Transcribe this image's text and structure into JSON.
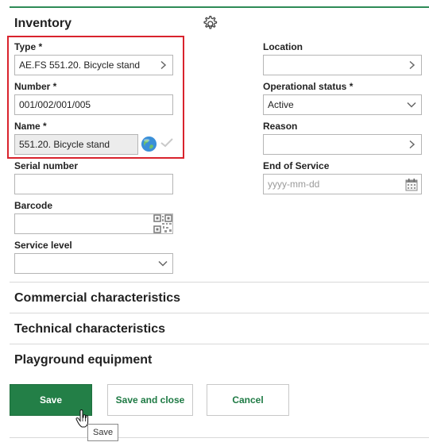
{
  "inventory": {
    "title": "Inventory",
    "left": {
      "type": {
        "label": "Type *",
        "value": "AE.FS 551.20. Bicycle stand"
      },
      "number": {
        "label": "Number *",
        "value": "001/002/001/005"
      },
      "name": {
        "label": "Name *",
        "value": "551.20. Bicycle stand"
      },
      "serial_number": {
        "label": "Serial number",
        "value": ""
      },
      "barcode": {
        "label": "Barcode",
        "value": ""
      },
      "service_level": {
        "label": "Service level",
        "value": ""
      }
    },
    "right": {
      "location": {
        "label": "Location",
        "value": ""
      },
      "operational_status": {
        "label": "Operational status *",
        "value": "Active"
      },
      "reason": {
        "label": "Reason",
        "value": ""
      },
      "end_of_service": {
        "label": "End of Service",
        "placeholder": "yyyy-mm-dd"
      }
    }
  },
  "sections": {
    "commercial": "Commercial characteristics",
    "technical": "Technical characteristics",
    "playground": "Playground equipment"
  },
  "buttons": {
    "save": "Save",
    "save_and_close": "Save and close",
    "cancel": "Cancel"
  },
  "tooltip": {
    "text": "Save"
  },
  "colors": {
    "accent": "#237f47",
    "highlight_box": "#d9232d"
  }
}
